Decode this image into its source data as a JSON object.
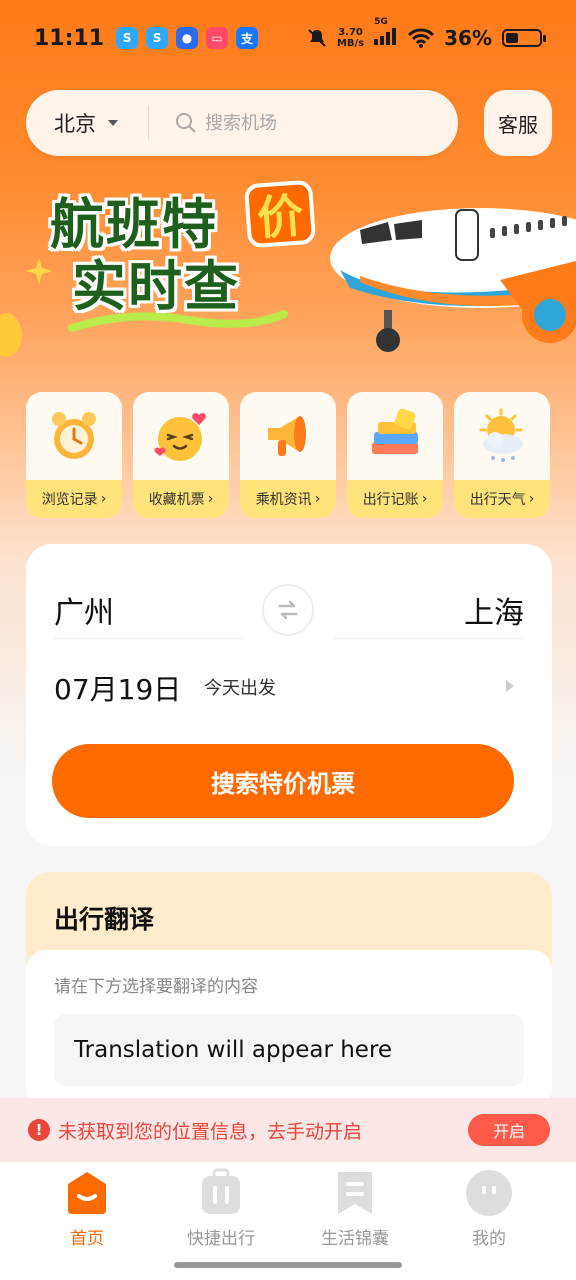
{
  "status_bar": {
    "time": "11:11",
    "speed_value": "3.70",
    "speed_unit": "MB/s",
    "network": "5G",
    "battery_percent": "36%",
    "battery_level": 0.36
  },
  "header": {
    "city": "北京",
    "search_placeholder": "搜索机场",
    "service_label": "客服"
  },
  "banner": {
    "title_line1": "航班特",
    "badge": "价",
    "title_line2": "实时查"
  },
  "quick_entries": [
    {
      "label": "浏览记录",
      "icon": "alarm-clock-icon"
    },
    {
      "label": "收藏机票",
      "icon": "heart-eyes-emoji-icon"
    },
    {
      "label": "乘机资讯",
      "icon": "megaphone-icon"
    },
    {
      "label": "出行记账",
      "icon": "books-icon"
    },
    {
      "label": "出行天气",
      "icon": "sun-cloud-icon"
    }
  ],
  "booking": {
    "from_city": "广州",
    "to_city": "上海",
    "date": "07月19日",
    "date_note": "今天出发",
    "search_button": "搜索特价机票"
  },
  "translation": {
    "title": "出行翻译",
    "hint": "请在下方选择要翻译的内容",
    "output": "Translation will appear here"
  },
  "location_notice": {
    "text": "未获取到您的位置信息，去手动开启",
    "button": "开启"
  },
  "bottom_nav": [
    {
      "label": "首页",
      "active": true
    },
    {
      "label": "快捷出行",
      "active": false
    },
    {
      "label": "生活锦囊",
      "active": false
    },
    {
      "label": "我的",
      "active": false
    }
  ],
  "colors": {
    "primary": "#ff6a00",
    "quick_label_bg": "#ffe37a",
    "notice_red": "#e8453c"
  }
}
